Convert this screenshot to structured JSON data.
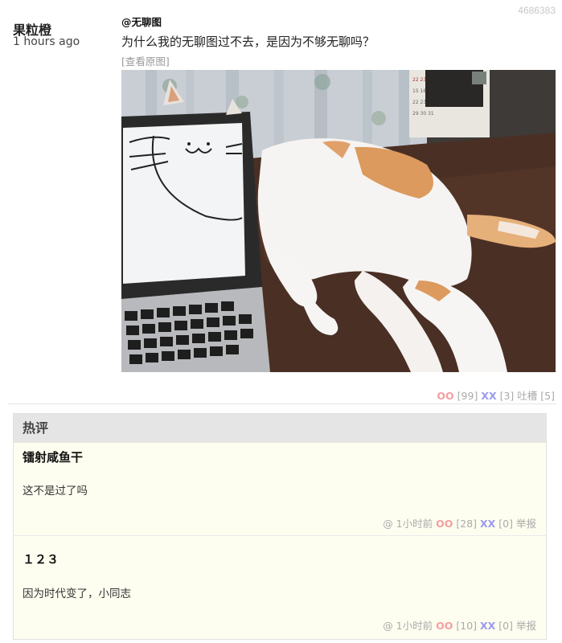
{
  "post": {
    "id": "4686383",
    "author": "果粒橙",
    "time": "1 hours ago",
    "tag": "@无聊图",
    "text": "为什么我的无聊图过不去，是因为不够无聊吗？",
    "view_original": "[查看原图]",
    "vote_oo_label": "OO",
    "vote_oo_count": "[99]",
    "vote_xx_label": "XX",
    "vote_xx_count": "[3]",
    "tucao_label": "吐槽",
    "tucao_count": "[5]"
  },
  "hot": {
    "title": "热评",
    "comments": [
      {
        "author": "镭射咸鱼干",
        "text": "这不是过了吗",
        "at": "@",
        "time": "1小时前",
        "oo": "OO",
        "oo_count": "[28]",
        "xx": "XX",
        "xx_count": "[0]",
        "report": "举报"
      },
      {
        "author": "１２３",
        "text": "因为时代变了，小同志",
        "at": "@",
        "time": "1小时前",
        "oo": "OO",
        "oo_count": "[10]",
        "xx": "XX",
        "xx_count": "[0]",
        "report": "举报"
      }
    ]
  },
  "colors": {
    "oo": "#f49ea0",
    "xx": "#9a9aef",
    "hot_bg": "#fefef0",
    "hot_header_bg": "#e5e5e5"
  }
}
